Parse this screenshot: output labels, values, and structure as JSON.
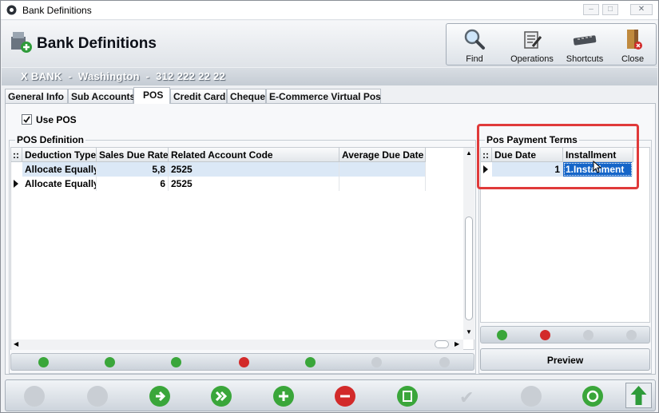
{
  "window": {
    "title": "Bank Definitions",
    "minimize": "–",
    "maximize": "□",
    "close": "✕"
  },
  "header": {
    "title": "Bank Definitions"
  },
  "toolbar": {
    "find": "Find",
    "operations": "Operations",
    "shortcuts": "Shortcuts",
    "close": "Close"
  },
  "bank_line": "X BANK  -  Washington  -  312 222 22 22",
  "tabs": [
    "General Info",
    "Sub Accounts",
    "POS",
    "Credit Card",
    "Cheque",
    "E-Commerce Virtual Pos"
  ],
  "active_tab": "POS",
  "use_pos": {
    "label": "Use POS",
    "checked": true
  },
  "pos_definition": {
    "label": "POS Definition",
    "columns": [
      "Deduction Type",
      "Sales Due Rate",
      "Related Account Code",
      "Average Due Date"
    ],
    "rows": [
      {
        "deduction_type": "Allocate Equally",
        "sales_due_rate": "5,8",
        "related_account_code": "2525",
        "average_due_date": ""
      },
      {
        "deduction_type": "Allocate Equally",
        "sales_due_rate": "6",
        "related_account_code": "2525",
        "average_due_date": ""
      }
    ]
  },
  "pos_payment_terms": {
    "label": "Pos Payment Terms",
    "columns": [
      "Due Date",
      "Installment"
    ],
    "rows": [
      {
        "due_date": "1",
        "installment": "1.Installment"
      }
    ]
  },
  "preview_button": "Preview",
  "colors": {
    "highlight_box": "#e03a3a",
    "selected_cell": "#1565c8",
    "green": "#3aa63a",
    "red": "#d22a2a"
  }
}
